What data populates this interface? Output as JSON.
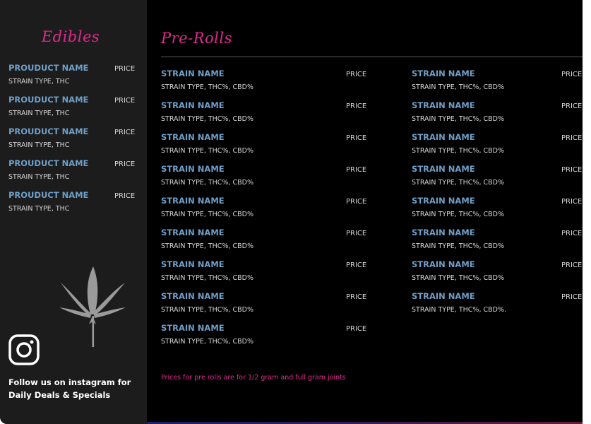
{
  "edibles": {
    "title": "Edibles",
    "items": [
      {
        "name": "PROUDUCT NAME",
        "price": "PRICE",
        "detail": "STRAIN TYPE, THC"
      },
      {
        "name": "PROUDUCT NAME",
        "price": "PRICE",
        "detail": "STRAIN TYPE, THC"
      },
      {
        "name": "PROUDUCT NAME",
        "price": "PRICE",
        "detail": "STRAIN TYPE, THC"
      },
      {
        "name": "PROUDUCT NAME",
        "price": "PRICE",
        "detail": "STRAIN TYPE, THC"
      },
      {
        "name": "PROUDUCT NAME",
        "price": "PRICE",
        "detail": "STRAIN TYPE, THC"
      }
    ]
  },
  "follow": {
    "line1": "Follow us on instagram for",
    "line2": "Daily Deals & Specials"
  },
  "prerolls": {
    "title": "Pre-Rolls",
    "left": [
      {
        "name": "STRAIN NAME",
        "price": "PRICE",
        "detail": "STRAIN TYPE, THC%, CBD%"
      },
      {
        "name": "STRAIN NAME",
        "price": "PRICE",
        "detail": "STRAIN TYPE, THC%, CBD%"
      },
      {
        "name": "STRAIN NAME",
        "price": "PRICE",
        "detail": "STRAIN TYPE, THC%, CBD%"
      },
      {
        "name": "STRAIN NAME",
        "price": "PRICE",
        "detail": "STRAIN TYPE, THC%, CBD%"
      },
      {
        "name": "STRAIN NAME",
        "price": "PRICE",
        "detail": "STRAIN TYPE, THC%, CBD%"
      },
      {
        "name": "STRAIN NAME",
        "price": "PRICE",
        "detail": "STRAIN TYPE, THC%, CBD%"
      },
      {
        "name": "STRAIN NAME",
        "price": "PRICE",
        "detail": "STRAIN TYPE, THC%, CBD%"
      },
      {
        "name": "STRAIN NAME",
        "price": "PRICE",
        "detail": "STRAIN TYPE, THC%, CBD%"
      },
      {
        "name": "STRAIN NAME",
        "price": "PRICE",
        "detail": "STRAIN TYPE, THC%, CBD%"
      }
    ],
    "right": [
      {
        "name": "STRAIN NAME",
        "price": "PRICE",
        "detail": "STRAIN TYPE, THC%, CBD%"
      },
      {
        "name": "STRAIN NAME",
        "price": "PRICE",
        "detail": "STRAIN TYPE, THC%, CBD%"
      },
      {
        "name": "STRAIN NAME",
        "price": "PRICE",
        "detail": "STRAIN TYPE, THC%, CBD%"
      },
      {
        "name": "STRAIN NAME",
        "price": "PRICE",
        "detail": "STRAIN TYPE, THC%, CBD%"
      },
      {
        "name": "STRAIN NAME",
        "price": "PRICE",
        "detail": "STRAIN TYPE, THC%, CBD%"
      },
      {
        "name": "STRAIN NAME",
        "price": "PRICE",
        "detail": "STRAIN TYPE, THC%, CBD%"
      },
      {
        "name": "STRAIN NAME",
        "price": "PRICE",
        "detail": "STRAIN TYPE, THC%, CBD%"
      },
      {
        "name": "STRAIN NAME",
        "price": "PRICE",
        "detail": "STRAIN TYPE, THC%, CBD%."
      }
    ],
    "note": "Prices for pre rolls are for 1/2 gram and full gram joints"
  },
  "icons": {
    "leaf": "cannabis-leaf-icon",
    "instagram": "instagram-icon"
  },
  "colors": {
    "accent_pink": "#e0298f",
    "name_blue": "#6f9fc8",
    "sidebar_bg": "#1c1c1c",
    "main_bg": "#000000",
    "leaf_gray": "#9a9a9a"
  }
}
